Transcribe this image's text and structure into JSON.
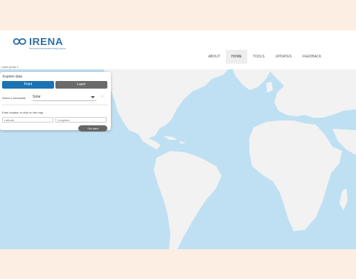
{
  "header": {
    "logo_word": "IRENA",
    "logo_subtitle": "International Renewable Energy Agency",
    "nav": [
      "ABOUT",
      "HOME",
      "TOOLS",
      "UPDATES",
      "FEEDBACK"
    ],
    "active_nav": "HOME"
  },
  "map": {
    "layer_label": "Layer group 1",
    "ocean_color": "#bfe0f3",
    "land_color": "#f2f2f2"
  },
  "panel": {
    "title": "Explore data",
    "tabs": {
      "point": "Point",
      "layer": "Layer"
    },
    "active_tab": "Point",
    "select_label": "Select a renewable",
    "select_value": "Solar",
    "close_symbol": "×",
    "location_label": "Enter location or click on the map",
    "latitude_placeholder": "Latitude",
    "longitude_placeholder": "Longitude",
    "get_data_label": "Get data"
  },
  "colors": {
    "accent": "#1b73b3",
    "secondary_button": "#6a6a6a"
  }
}
